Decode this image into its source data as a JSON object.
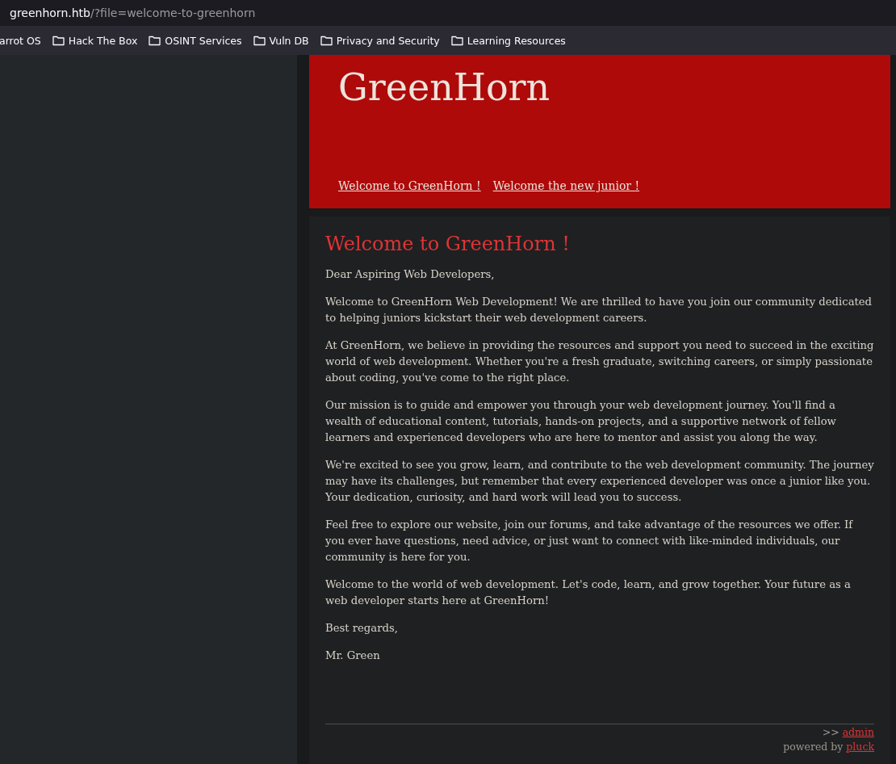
{
  "address_bar": {
    "host": "greenhorn.htb",
    "path": "/?file=welcome-to-greenhorn"
  },
  "bookmarks": [
    {
      "label": "arrot OS",
      "icon": false
    },
    {
      "label": "Hack The Box",
      "icon": true
    },
    {
      "label": "OSINT Services",
      "icon": true
    },
    {
      "label": "Vuln DB",
      "icon": true
    },
    {
      "label": "Privacy and Security",
      "icon": true
    },
    {
      "label": "Learning Resources",
      "icon": true
    }
  ],
  "header": {
    "title": "GreenHorn",
    "nav": [
      "Welcome to GreenHorn !",
      "Welcome the new junior !"
    ]
  },
  "article": {
    "heading": "Welcome to GreenHorn !",
    "paragraphs": [
      "Dear Aspiring Web Developers,",
      "Welcome to GreenHorn Web Development! We are thrilled to have you join our community dedicated to helping juniors kickstart their web development careers.",
      "At GreenHorn, we believe in providing the resources and support you need to succeed in the exciting world of web development. Whether you're a fresh graduate, switching careers, or simply passionate about coding, you've come to the right place.",
      "Our mission is to guide and empower you through your web development journey. You'll find a wealth of educational content, tutorials, hands-on projects, and a supportive network of fellow learners and experienced developers who are here to mentor and assist you along the way.",
      "We're excited to see you grow, learn, and contribute to the web development community. The journey may have its challenges, but remember that every experienced developer was once a junior like you. Your dedication, curiosity, and hard work will lead you to success.",
      "Feel free to explore our website, join our forums, and take advantage of the resources we offer. If you ever have questions, need advice, or just want to connect with like-minded individuals, our community is here for you.",
      "Welcome to the world of web development. Let's code, learn, and grow together. Your future as a web developer starts here at GreenHorn!",
      "Best regards,",
      "Mr. Green"
    ]
  },
  "footer": {
    "admin_prefix": ">>",
    "admin_link": "admin",
    "powered_prefix": "powered by",
    "powered_link": "pluck"
  }
}
